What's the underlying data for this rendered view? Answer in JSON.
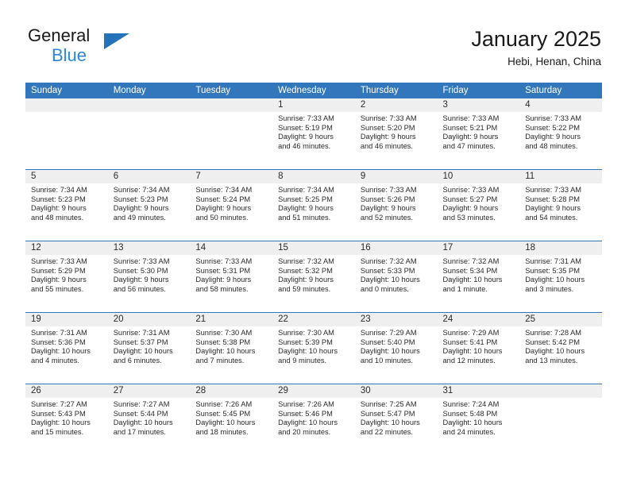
{
  "brand": {
    "name_top": "General",
    "name_bottom": "Blue",
    "triangle_color": "#2472b8",
    "blue_text_color": "#2e87d6"
  },
  "header": {
    "title": "January 2025",
    "location": "Hebi, Henan, China"
  },
  "theme": {
    "header_blue": "#3277bc",
    "daynum_band": "#efefef",
    "text": "#2b2b2b"
  },
  "calendar": {
    "weekday_headers": [
      "Sunday",
      "Monday",
      "Tuesday",
      "Wednesday",
      "Thursday",
      "Friday",
      "Saturday"
    ],
    "weeks": [
      [
        {
          "day": "",
          "lines": []
        },
        {
          "day": "",
          "lines": []
        },
        {
          "day": "",
          "lines": []
        },
        {
          "day": "1",
          "lines": [
            "Sunrise: 7:33 AM",
            "Sunset: 5:19 PM",
            "Daylight: 9 hours",
            "and 46 minutes."
          ]
        },
        {
          "day": "2",
          "lines": [
            "Sunrise: 7:33 AM",
            "Sunset: 5:20 PM",
            "Daylight: 9 hours",
            "and 46 minutes."
          ]
        },
        {
          "day": "3",
          "lines": [
            "Sunrise: 7:33 AM",
            "Sunset: 5:21 PM",
            "Daylight: 9 hours",
            "and 47 minutes."
          ]
        },
        {
          "day": "4",
          "lines": [
            "Sunrise: 7:33 AM",
            "Sunset: 5:22 PM",
            "Daylight: 9 hours",
            "and 48 minutes."
          ]
        }
      ],
      [
        {
          "day": "5",
          "lines": [
            "Sunrise: 7:34 AM",
            "Sunset: 5:23 PM",
            "Daylight: 9 hours",
            "and 48 minutes."
          ]
        },
        {
          "day": "6",
          "lines": [
            "Sunrise: 7:34 AM",
            "Sunset: 5:23 PM",
            "Daylight: 9 hours",
            "and 49 minutes."
          ]
        },
        {
          "day": "7",
          "lines": [
            "Sunrise: 7:34 AM",
            "Sunset: 5:24 PM",
            "Daylight: 9 hours",
            "and 50 minutes."
          ]
        },
        {
          "day": "8",
          "lines": [
            "Sunrise: 7:34 AM",
            "Sunset: 5:25 PM",
            "Daylight: 9 hours",
            "and 51 minutes."
          ]
        },
        {
          "day": "9",
          "lines": [
            "Sunrise: 7:33 AM",
            "Sunset: 5:26 PM",
            "Daylight: 9 hours",
            "and 52 minutes."
          ]
        },
        {
          "day": "10",
          "lines": [
            "Sunrise: 7:33 AM",
            "Sunset: 5:27 PM",
            "Daylight: 9 hours",
            "and 53 minutes."
          ]
        },
        {
          "day": "11",
          "lines": [
            "Sunrise: 7:33 AM",
            "Sunset: 5:28 PM",
            "Daylight: 9 hours",
            "and 54 minutes."
          ]
        }
      ],
      [
        {
          "day": "12",
          "lines": [
            "Sunrise: 7:33 AM",
            "Sunset: 5:29 PM",
            "Daylight: 9 hours",
            "and 55 minutes."
          ]
        },
        {
          "day": "13",
          "lines": [
            "Sunrise: 7:33 AM",
            "Sunset: 5:30 PM",
            "Daylight: 9 hours",
            "and 56 minutes."
          ]
        },
        {
          "day": "14",
          "lines": [
            "Sunrise: 7:33 AM",
            "Sunset: 5:31 PM",
            "Daylight: 9 hours",
            "and 58 minutes."
          ]
        },
        {
          "day": "15",
          "lines": [
            "Sunrise: 7:32 AM",
            "Sunset: 5:32 PM",
            "Daylight: 9 hours",
            "and 59 minutes."
          ]
        },
        {
          "day": "16",
          "lines": [
            "Sunrise: 7:32 AM",
            "Sunset: 5:33 PM",
            "Daylight: 10 hours",
            "and 0 minutes."
          ]
        },
        {
          "day": "17",
          "lines": [
            "Sunrise: 7:32 AM",
            "Sunset: 5:34 PM",
            "Daylight: 10 hours",
            "and 1 minute."
          ]
        },
        {
          "day": "18",
          "lines": [
            "Sunrise: 7:31 AM",
            "Sunset: 5:35 PM",
            "Daylight: 10 hours",
            "and 3 minutes."
          ]
        }
      ],
      [
        {
          "day": "19",
          "lines": [
            "Sunrise: 7:31 AM",
            "Sunset: 5:36 PM",
            "Daylight: 10 hours",
            "and 4 minutes."
          ]
        },
        {
          "day": "20",
          "lines": [
            "Sunrise: 7:31 AM",
            "Sunset: 5:37 PM",
            "Daylight: 10 hours",
            "and 6 minutes."
          ]
        },
        {
          "day": "21",
          "lines": [
            "Sunrise: 7:30 AM",
            "Sunset: 5:38 PM",
            "Daylight: 10 hours",
            "and 7 minutes."
          ]
        },
        {
          "day": "22",
          "lines": [
            "Sunrise: 7:30 AM",
            "Sunset: 5:39 PM",
            "Daylight: 10 hours",
            "and 9 minutes."
          ]
        },
        {
          "day": "23",
          "lines": [
            "Sunrise: 7:29 AM",
            "Sunset: 5:40 PM",
            "Daylight: 10 hours",
            "and 10 minutes."
          ]
        },
        {
          "day": "24",
          "lines": [
            "Sunrise: 7:29 AM",
            "Sunset: 5:41 PM",
            "Daylight: 10 hours",
            "and 12 minutes."
          ]
        },
        {
          "day": "25",
          "lines": [
            "Sunrise: 7:28 AM",
            "Sunset: 5:42 PM",
            "Daylight: 10 hours",
            "and 13 minutes."
          ]
        }
      ],
      [
        {
          "day": "26",
          "lines": [
            "Sunrise: 7:27 AM",
            "Sunset: 5:43 PM",
            "Daylight: 10 hours",
            "and 15 minutes."
          ]
        },
        {
          "day": "27",
          "lines": [
            "Sunrise: 7:27 AM",
            "Sunset: 5:44 PM",
            "Daylight: 10 hours",
            "and 17 minutes."
          ]
        },
        {
          "day": "28",
          "lines": [
            "Sunrise: 7:26 AM",
            "Sunset: 5:45 PM",
            "Daylight: 10 hours",
            "and 18 minutes."
          ]
        },
        {
          "day": "29",
          "lines": [
            "Sunrise: 7:26 AM",
            "Sunset: 5:46 PM",
            "Daylight: 10 hours",
            "and 20 minutes."
          ]
        },
        {
          "day": "30",
          "lines": [
            "Sunrise: 7:25 AM",
            "Sunset: 5:47 PM",
            "Daylight: 10 hours",
            "and 22 minutes."
          ]
        },
        {
          "day": "31",
          "lines": [
            "Sunrise: 7:24 AM",
            "Sunset: 5:48 PM",
            "Daylight: 10 hours",
            "and 24 minutes."
          ]
        },
        {
          "day": "",
          "lines": []
        }
      ]
    ]
  }
}
